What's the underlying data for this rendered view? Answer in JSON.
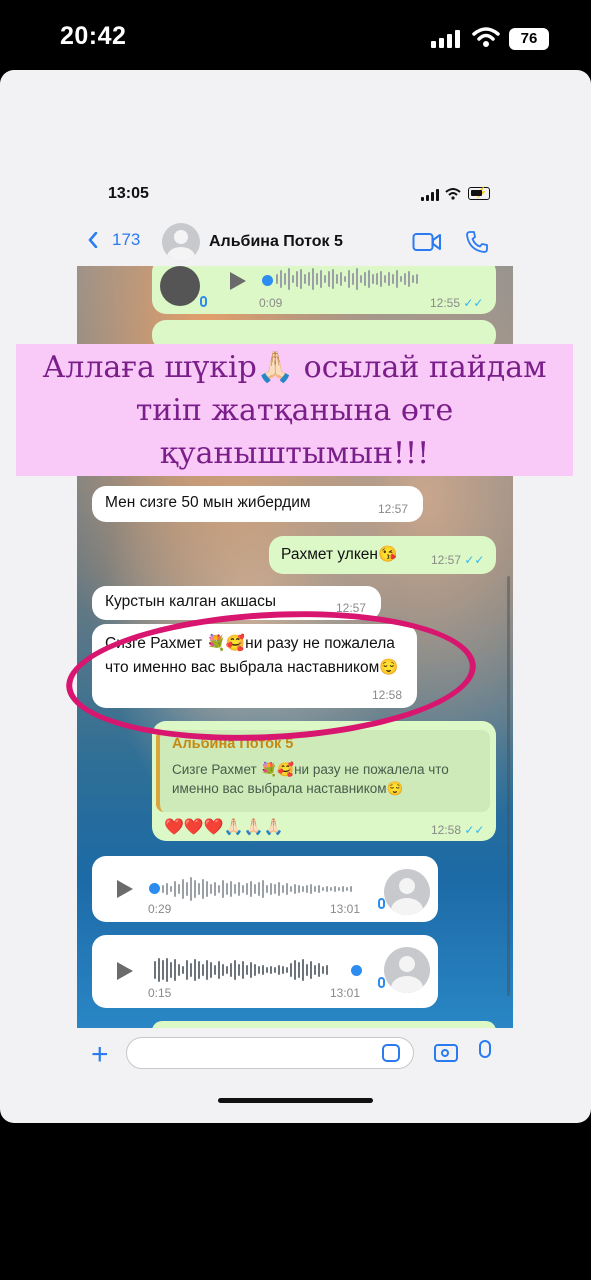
{
  "outer_status": {
    "time": "20:42",
    "battery": "76"
  },
  "inner_status": {
    "time": "13:05"
  },
  "header": {
    "back_count": "173",
    "contact_name": "Альбина Поток 5"
  },
  "banner": {
    "text": "Аллаға шүкір🙏🏻 осылай пайдам тиіп жатқанына өте қуаныштымын!!!"
  },
  "messages": [
    {
      "kind": "voice_out",
      "duration": "0:09",
      "time": "12:55"
    },
    {
      "kind": "text_in",
      "text": "Мен сизге 50 мын жибердим",
      "time": "12:57"
    },
    {
      "kind": "text_out",
      "text": "Рахмет улкен😘",
      "time": "12:57"
    },
    {
      "kind": "text_in",
      "text": "Курстын калган акшасы",
      "time": "12:57"
    },
    {
      "kind": "text_in",
      "text": "Сизге Рахмет 💐🥰ни разу не пожалела что именно вас выбрала наставником😌",
      "time": "12:58"
    },
    {
      "kind": "reply_out",
      "quote_author": "Альбина Поток 5",
      "quote_text": "Сизге Рахмет 💐🥰ни разу не пожалела что именно вас выбрала наставником😌",
      "text": "❤️❤️❤️🙏🏻🙏🏻🙏🏻",
      "time": "12:58"
    },
    {
      "kind": "voice_in",
      "duration": "0:29",
      "time": "13:01"
    },
    {
      "kind": "voice_in",
      "duration": "0:15",
      "time": "13:01"
    }
  ],
  "icons": {
    "video": "video-call-icon",
    "call": "phone-icon",
    "plus": "plus-icon",
    "sticker": "sticker-icon",
    "camera": "camera-icon",
    "mic": "microphone-icon"
  },
  "colors": {
    "accent": "#2a7bf0",
    "outgoing": "#dcf8c6",
    "highlight": "#d8156f",
    "banner_bg": "#f9c9f8",
    "banner_text": "#7a1f8a"
  }
}
